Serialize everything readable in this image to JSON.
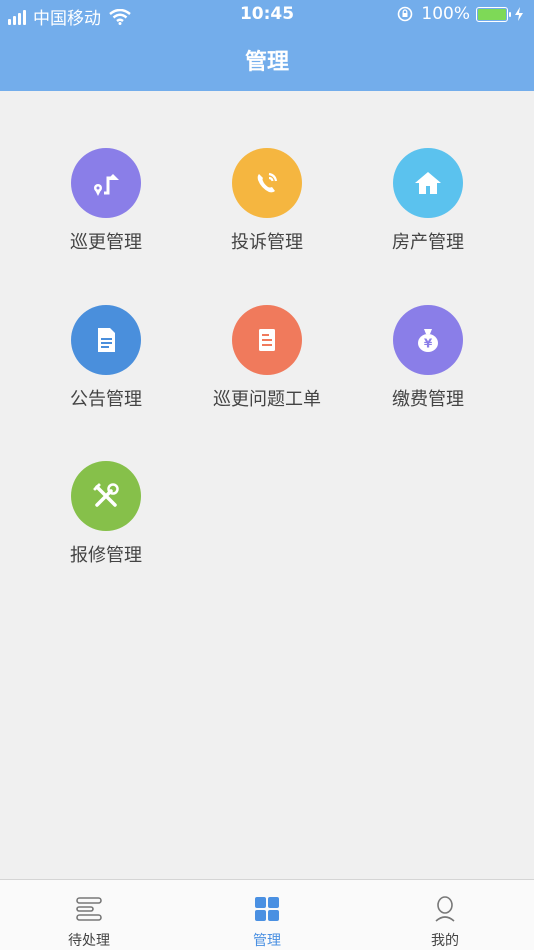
{
  "status": {
    "carrier": "中国移动",
    "time": "10:45",
    "battery": "100%"
  },
  "header": {
    "title": "管理"
  },
  "grid": {
    "items": [
      {
        "label": "巡更管理",
        "color": "#8a7ee8",
        "icon": "patrol-route-icon"
      },
      {
        "label": "投诉管理",
        "color": "#f5b640",
        "icon": "phone-icon"
      },
      {
        "label": "房产管理",
        "color": "#5bc2ee",
        "icon": "house-icon"
      },
      {
        "label": "公告管理",
        "color": "#4a8fdc",
        "icon": "document-icon"
      },
      {
        "label": "巡更问题工单",
        "color": "#f07a5c",
        "icon": "work-order-icon"
      },
      {
        "label": "缴费管理",
        "color": "#8a7ee8",
        "icon": "money-bag-icon"
      },
      {
        "label": "报修管理",
        "color": "#86c04a",
        "icon": "tools-icon"
      }
    ]
  },
  "tabbar": {
    "tabs": [
      {
        "label": "待处理",
        "icon": "list-icon",
        "active": false
      },
      {
        "label": "管理",
        "icon": "grid-icon",
        "active": true
      },
      {
        "label": "我的",
        "icon": "user-icon",
        "active": false
      }
    ],
    "active_color": "#4a90e2"
  }
}
